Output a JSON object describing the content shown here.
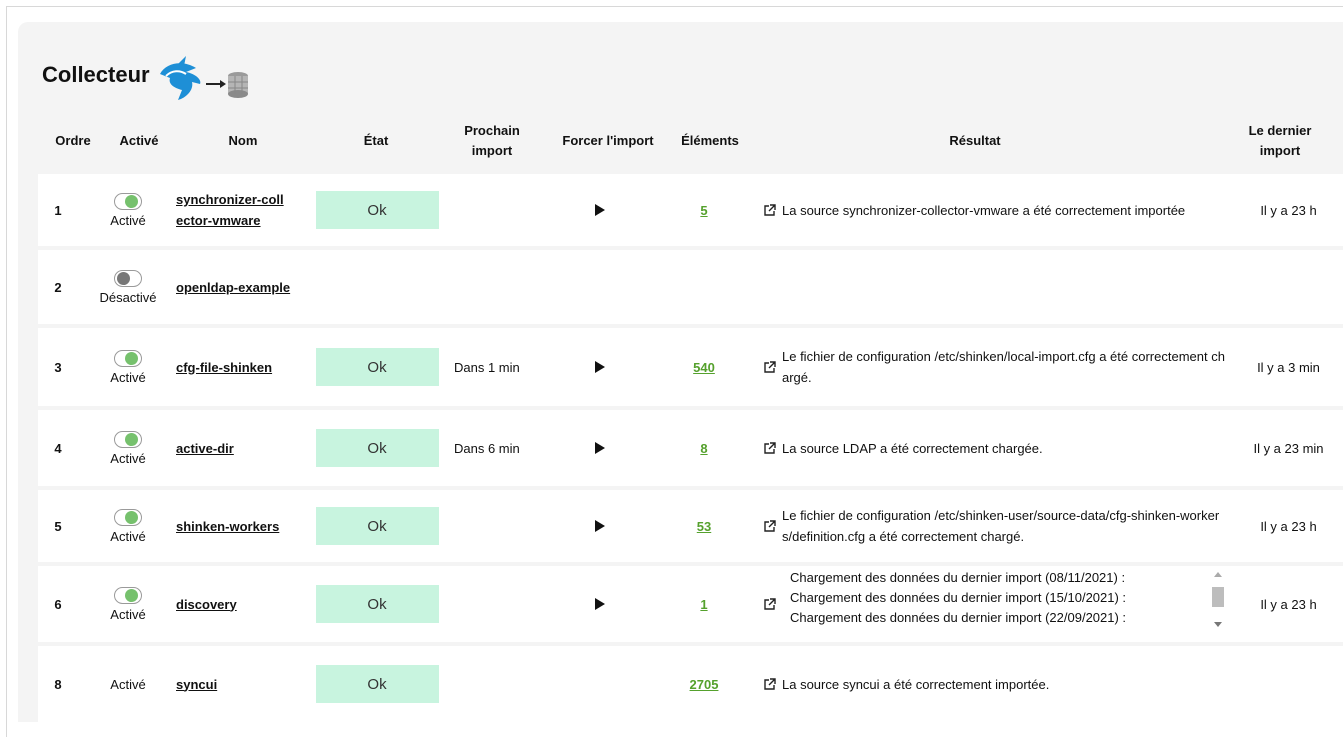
{
  "title": "Collecteur",
  "headers": {
    "ordre": "Ordre",
    "active": "Activé",
    "nom": "Nom",
    "etat": "État",
    "prochain": "Prochain import",
    "forcer": "Forcer l'import",
    "elements": "Éléments",
    "resultat": "Résultat",
    "dernier": "Le dernier import"
  },
  "rows": [
    {
      "ordre": "1",
      "active_label": "Activé",
      "name": "synchronizer-collector-vmware",
      "etat": "Ok",
      "next": "",
      "elements": "5",
      "result": "La source synchronizer-collector-vmware a été correctement importée",
      "last": "Il y a 23 h"
    },
    {
      "ordre": "2",
      "active_label": "Désactivé",
      "name": "openldap-example",
      "etat": "",
      "next": "",
      "elements": "",
      "result": "",
      "last": ""
    },
    {
      "ordre": "3",
      "active_label": "Activé",
      "name": "cfg-file-shinken",
      "etat": "Ok",
      "next": "Dans 1 min",
      "elements": "540",
      "result": "Le fichier de configuration /etc/shinken/local-import.cfg a été correctement chargé.",
      "last": "Il y a 3 min"
    },
    {
      "ordre": "4",
      "active_label": "Activé",
      "name": "active-dir",
      "etat": "Ok",
      "next": "Dans 6 min",
      "elements": "8",
      "result": "La source LDAP a été correctement chargée.",
      "last": "Il y a 23 min"
    },
    {
      "ordre": "5",
      "active_label": "Activé",
      "name": "shinken-workers",
      "etat": "Ok",
      "next": "",
      "elements": "53",
      "result": "Le fichier de configuration /etc/shinken-user/source-data/cfg-shinken-workers/definition.cfg a été correctement chargé.",
      "last": "Il y a 23 h"
    },
    {
      "ordre": "6",
      "active_label": "Activé",
      "name": "discovery",
      "etat": "Ok",
      "next": "",
      "elements": "1",
      "result_lines": [
        "Chargement des données du dernier import (08/11/2021) :",
        "Chargement des données du dernier import (15/10/2021) :",
        "Chargement des données du dernier import (22/09/2021) :"
      ],
      "last": "Il y a 23 h"
    },
    {
      "ordre": "8",
      "active_label": "Activé",
      "name": "syncui",
      "etat": "Ok",
      "next": "",
      "elements": "2705",
      "result": "La source syncui a été correctement importée.",
      "last": ""
    }
  ],
  "icons": {
    "toggle_on": "toggle-on-icon",
    "toggle_off": "toggle-off-icon",
    "play": "play-icon",
    "external": "external-link-icon"
  },
  "colors": {
    "ok_bg": "#c8f4df",
    "link_green": "#55a12d",
    "toggle_green": "#76c16d"
  }
}
